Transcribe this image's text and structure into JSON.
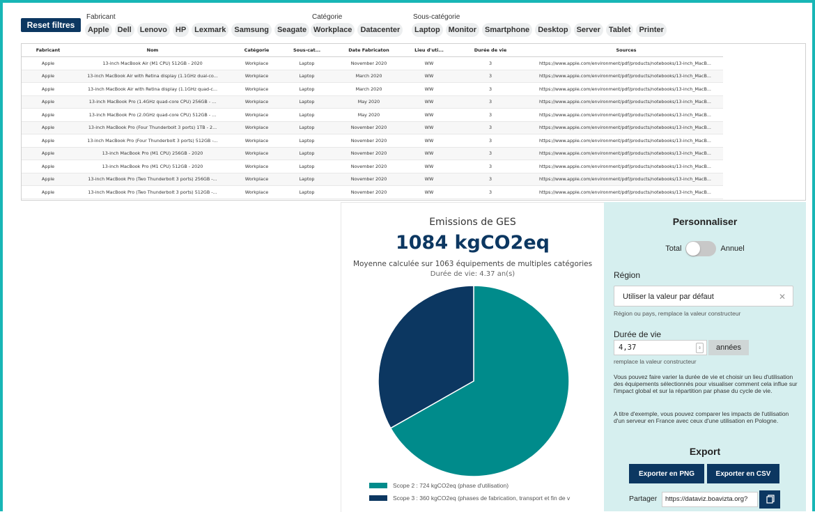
{
  "filters": {
    "reset_label": "Reset filtres",
    "fabricant": {
      "label": "Fabricant",
      "options": [
        "Apple",
        "Dell",
        "Lenovo",
        "HP",
        "Lexmark",
        "Samsung",
        "Seagate"
      ]
    },
    "categorie": {
      "label": "Catégorie",
      "options": [
        "Workplace",
        "Datacenter"
      ]
    },
    "sous_categorie": {
      "label": "Sous-catégorie",
      "options": [
        "Laptop",
        "Monitor",
        "Smartphone",
        "Desktop",
        "Server",
        "Tablet",
        "Printer"
      ]
    }
  },
  "table": {
    "headers": [
      "Fabricant",
      "Nom",
      "Catégorie",
      "Sous-cat...",
      "Date Fabricaton",
      "Lieu d'uti...",
      "Durée de vie",
      "Sources"
    ],
    "rows": [
      [
        "Apple",
        "13-inch MacBook Air (M1 CPU) 512GB - 2020",
        "Workplace",
        "Laptop",
        "November 2020",
        "WW",
        "3",
        "https://www.apple.com/environment/pdf/products/notebooks/13-inch_MacB..."
      ],
      [
        "Apple",
        "13-inch MacBook Air with Retina display (1.1GHz dual-co...",
        "Workplace",
        "Laptop",
        "March 2020",
        "WW",
        "3",
        "https://www.apple.com/environment/pdf/products/notebooks/13-inch_MacB..."
      ],
      [
        "Apple",
        "13-inch MacBook Air with Retina display (1.1GHz quad-c...",
        "Workplace",
        "Laptop",
        "March 2020",
        "WW",
        "3",
        "https://www.apple.com/environment/pdf/products/notebooks/13-inch_MacB..."
      ],
      [
        "Apple",
        "13-inch MacBook Pro (1.4GHz quad-core CPU) 256GB - ...",
        "Workplace",
        "Laptop",
        "May 2020",
        "WW",
        "3",
        "https://www.apple.com/environment/pdf/products/notebooks/13-inch_MacB..."
      ],
      [
        "Apple",
        "13-inch MacBook Pro (2.0GHz quad-core CPU) 512GB - ...",
        "Workplace",
        "Laptop",
        "May 2020",
        "WW",
        "3",
        "https://www.apple.com/environment/pdf/products/notebooks/13-inch_MacB..."
      ],
      [
        "Apple",
        "13-inch MacBook Pro (Four Thunderbolt 3 ports) 1TB - 2...",
        "Workplace",
        "Laptop",
        "November 2020",
        "WW",
        "3",
        "https://www.apple.com/environment/pdf/products/notebooks/13-inch_MacB..."
      ],
      [
        "Apple",
        "13-inch MacBook Pro (Four Thunderbolt 3 ports) 512GB -...",
        "Workplace",
        "Laptop",
        "November 2020",
        "WW",
        "3",
        "https://www.apple.com/environment/pdf/products/notebooks/13-inch_MacB..."
      ],
      [
        "Apple",
        "13-inch MacBook Pro (M1 CPU) 256GB - 2020",
        "Workplace",
        "Laptop",
        "November 2020",
        "WW",
        "3",
        "https://www.apple.com/environment/pdf/products/notebooks/13-inch_MacB..."
      ],
      [
        "Apple",
        "13-inch MacBook Pro (M1 CPU) 512GB - 2020",
        "Workplace",
        "Laptop",
        "November 2020",
        "WW",
        "3",
        "https://www.apple.com/environment/pdf/products/notebooks/13-inch_MacB..."
      ],
      [
        "Apple",
        "13-inch MacBook Pro (Two Thunderbolt 3 ports) 256GB -...",
        "Workplace",
        "Laptop",
        "November 2020",
        "WW",
        "3",
        "https://www.apple.com/environment/pdf/products/notebooks/13-inch_MacB..."
      ],
      [
        "Apple",
        "13-inch MacBook Pro (Two Thunderbolt 3 ports) 512GB -...",
        "Workplace",
        "Laptop",
        "November 2020",
        "WW",
        "3",
        "https://www.apple.com/environment/pdf/products/notebooks/13-inch_MacB..."
      ]
    ]
  },
  "chart": {
    "title": "Emissions de GES",
    "total": "1084 kgCO2eq",
    "average_text": "Moyenne calculée sur 1063 équipements de multiples catégories",
    "lifetime_text": "Durée de vie: 4.37 an(s)"
  },
  "chart_data": {
    "type": "pie",
    "title": "Emissions de GES",
    "unit": "kgCO2eq",
    "slices": [
      {
        "label": "Scope 2 : 724 kgCO2eq (phase d'utilisation)",
        "value": 724,
        "color": "#008b8b"
      },
      {
        "label": "Scope 3 : 360 kgCO2eq (phases de fabrication, transport et fin de v",
        "value": 360,
        "color": "#0c3761"
      }
    ]
  },
  "customize": {
    "title": "Personnaliser",
    "toggle_left": "Total",
    "toggle_right": "Annuel",
    "region_label": "Région",
    "region_value": "Utiliser la valeur par défaut",
    "region_clear": "✕",
    "region_hint": "Région ou pays, remplace la valeur constructeur",
    "duree_label": "Durée de vie",
    "duree_value": "4,37",
    "duree_unit": "années",
    "duree_hint": "remplace la valeur constructeur",
    "paragraph1": "Vous pouvez faire varier la durée de vie et choisir un lieu d'utilisation des équipements sélectionnés pour visualiser comment cela influe sur l'impact global et sur la répartition par phase du cycle de vie.",
    "paragraph2": "A titre d'exemple, vous pouvez comparer les impacts de l'utilisation d'un serveur en France avec ceux d'une utilisation en Pologne."
  },
  "export": {
    "title": "Export",
    "png_label": "Exporter en PNG",
    "csv_label": "Exporter en CSV",
    "share_label": "Partager",
    "share_url": "https://dataviz.boavizta.org?",
    "copy_icon": "copy-icon"
  },
  "colors": {
    "navy": "#0c3761",
    "teal": "#008b8b",
    "border": "#18b6b6",
    "panel": "#d6efef"
  }
}
